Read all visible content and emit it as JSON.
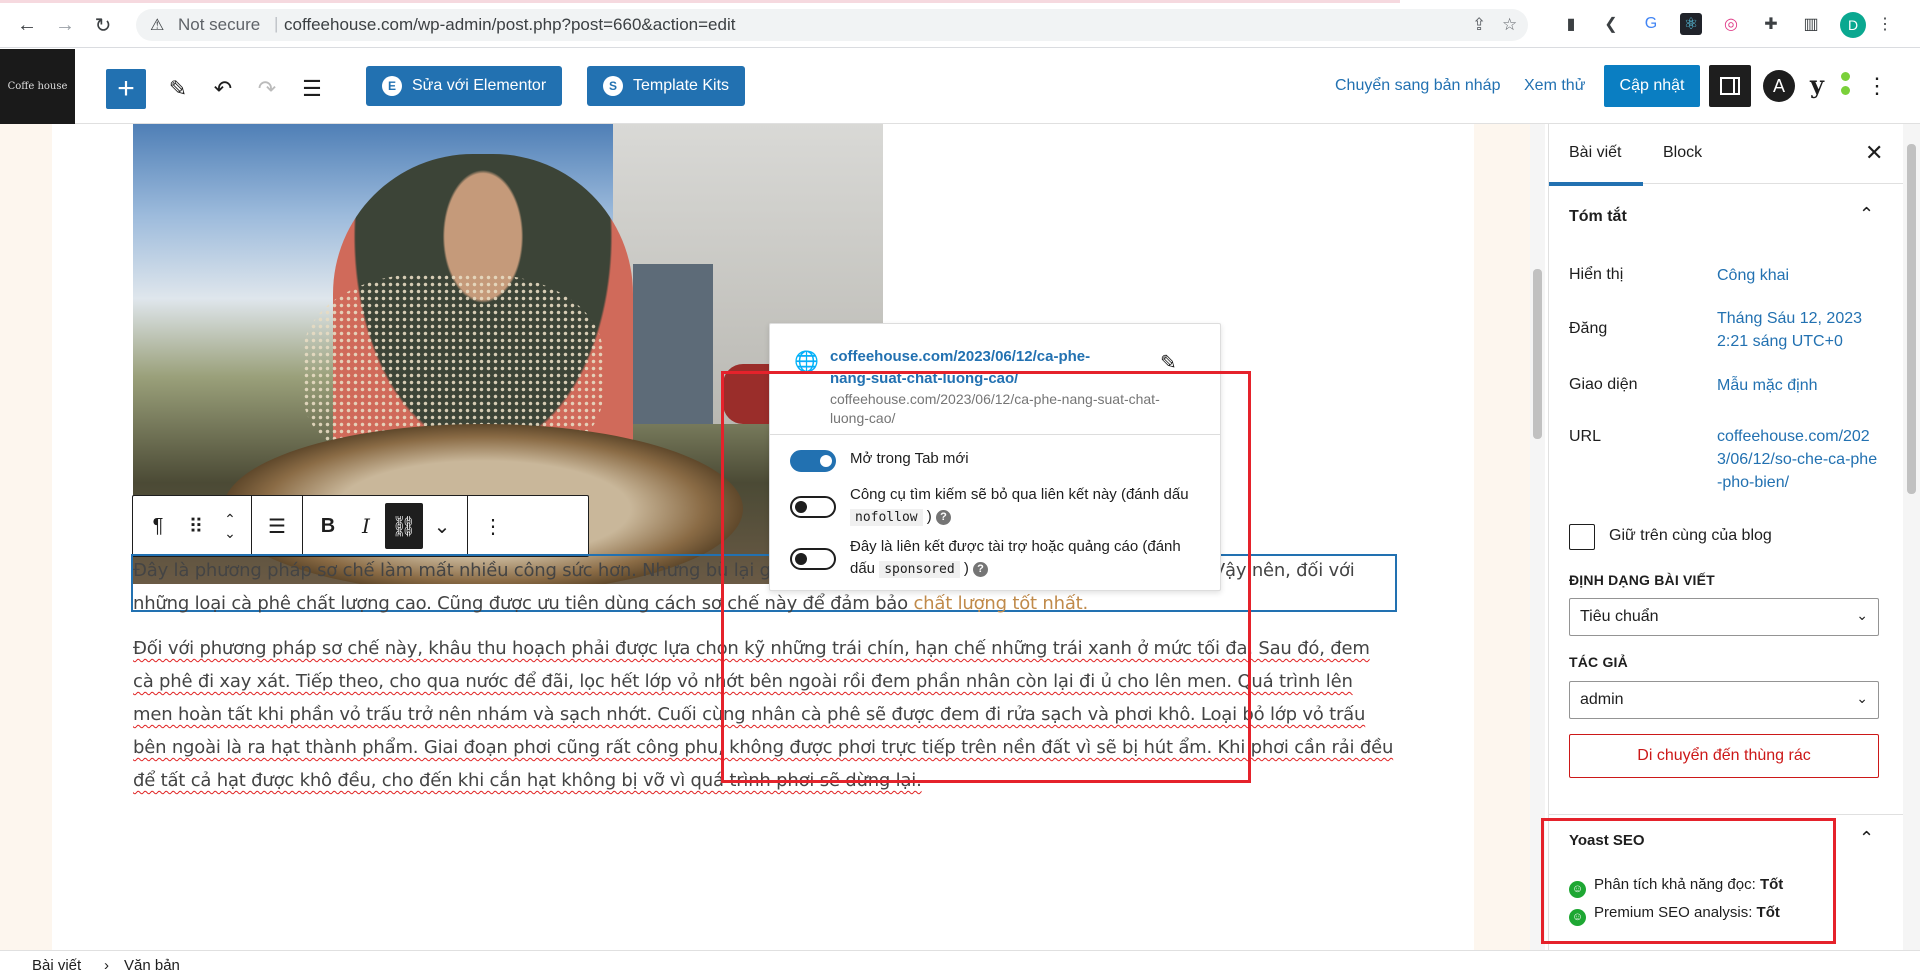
{
  "browser": {
    "security": "Not secure",
    "url": "coffeehouse.com/wp-admin/post.php?post=660&action=edit",
    "profile_initial": "D"
  },
  "toolbar": {
    "logo_text": "Coffe house",
    "elementor_label": "Sửa với Elementor",
    "template_kits_label": "Template Kits",
    "draft_label": "Chuyển sang bản nháp",
    "preview_label": "Xem thử",
    "update_label": "Cập nhật"
  },
  "content": {
    "para1_a": "Đây là phương pháp sơ chế làm mất nhiều công sức hơn. Nhưng bù lại g",
    "para1_b": "Vậy nên, đối với",
    "para1_c": "những loại cà phê chất lượng cao. Cũng được ưu tiên dùng cách sơ chế này để đảm bảo ",
    "para1_link": "chất lượng tốt nhất.",
    "para2": "Đối với phương pháp sơ chế này, khâu thu hoạch phải được lựa chọn kỹ những trái chín, hạn chế những trái xanh ở mức tối đa. Sau đó, đem cà phê đi xay xát. Tiếp theo, cho qua nước để đãi, lọc hết lớp vỏ nhớt bên ngoài rồi đem phần nhân còn lại đi ủ cho lên men. Quá trình lên men hoàn tất khi phần vỏ trấu trở nên nhám và sạch nhớt. Cuối cùng nhân cà phê sẽ được đem đi rửa sạch và phơi khô. Loại bỏ lớp vỏ trấu bên ngoài là ra hạt thành phẩm. Giai đoạn phơi cũng rất công phu, không được phơi trực tiếp trên nền đất vì sẽ bị hút ẩm. Khi phơi cần rải đều để tất cả hạt được khô đều, cho đến khi cắn hạt không bị vỡ vì quá trình phơi sẽ dừng lại."
  },
  "link_popover": {
    "link_title": "coffeehouse.com/2023/06/12/ca-phe-nang-suat-chat-luong-cao/",
    "link_url": "coffeehouse.com/2023/06/12/ca-phe-nang-suat-chat-luong-cao/",
    "opt_newtab": "Mở trong Tab mới",
    "opt_nofollow_a": "Công cụ tìm kiếm sẽ bỏ qua liên kết này (đánh dấu ",
    "opt_nofollow_code": "nofollow",
    "opt_nofollow_b": " )",
    "opt_sponsored_a": "Đây là liên kết được tài trợ hoặc quảng cáo (đánh dấu ",
    "opt_sponsored_code": "sponsored",
    "opt_sponsored_b": " )",
    "newtab_on": true,
    "nofollow_on": false,
    "sponsored_on": false
  },
  "sidebar": {
    "tab_post": "Bài viết",
    "tab_block": "Block",
    "summary_title": "Tóm tắt",
    "visibility_label": "Hiển thị",
    "visibility_value": "Công khai",
    "publish_label": "Đăng",
    "publish_value": "Tháng Sáu 12, 2023 2:21 sáng UTC+0",
    "template_label": "Giao diện",
    "template_value": "Mẫu mặc định",
    "url_label": "URL",
    "url_value": "coffeehouse.com/2023/06/12/so-che-ca-phe-pho-bien/",
    "sticky_label": "Giữ trên cùng của blog",
    "format_heading": "ĐỊNH DẠNG BÀI VIẾT",
    "format_value": "Tiêu chuẩn",
    "author_heading": "TÁC GIẢ",
    "author_value": "admin",
    "trash_label": "Di chuyển đến thùng rác",
    "yoast_title": "Yoast SEO",
    "yoast_read_label": "Phân tích khả năng đọc: ",
    "yoast_read_value": "Tốt",
    "yoast_seo_label": "Premium SEO analysis: ",
    "yoast_seo_value": "Tốt"
  },
  "footer": {
    "crumb1": "Bài viết",
    "crumb2": "Văn bản"
  },
  "colors": {
    "accent": "#2271b1",
    "annotation_red": "#e5222b",
    "good": "#1ea733"
  }
}
